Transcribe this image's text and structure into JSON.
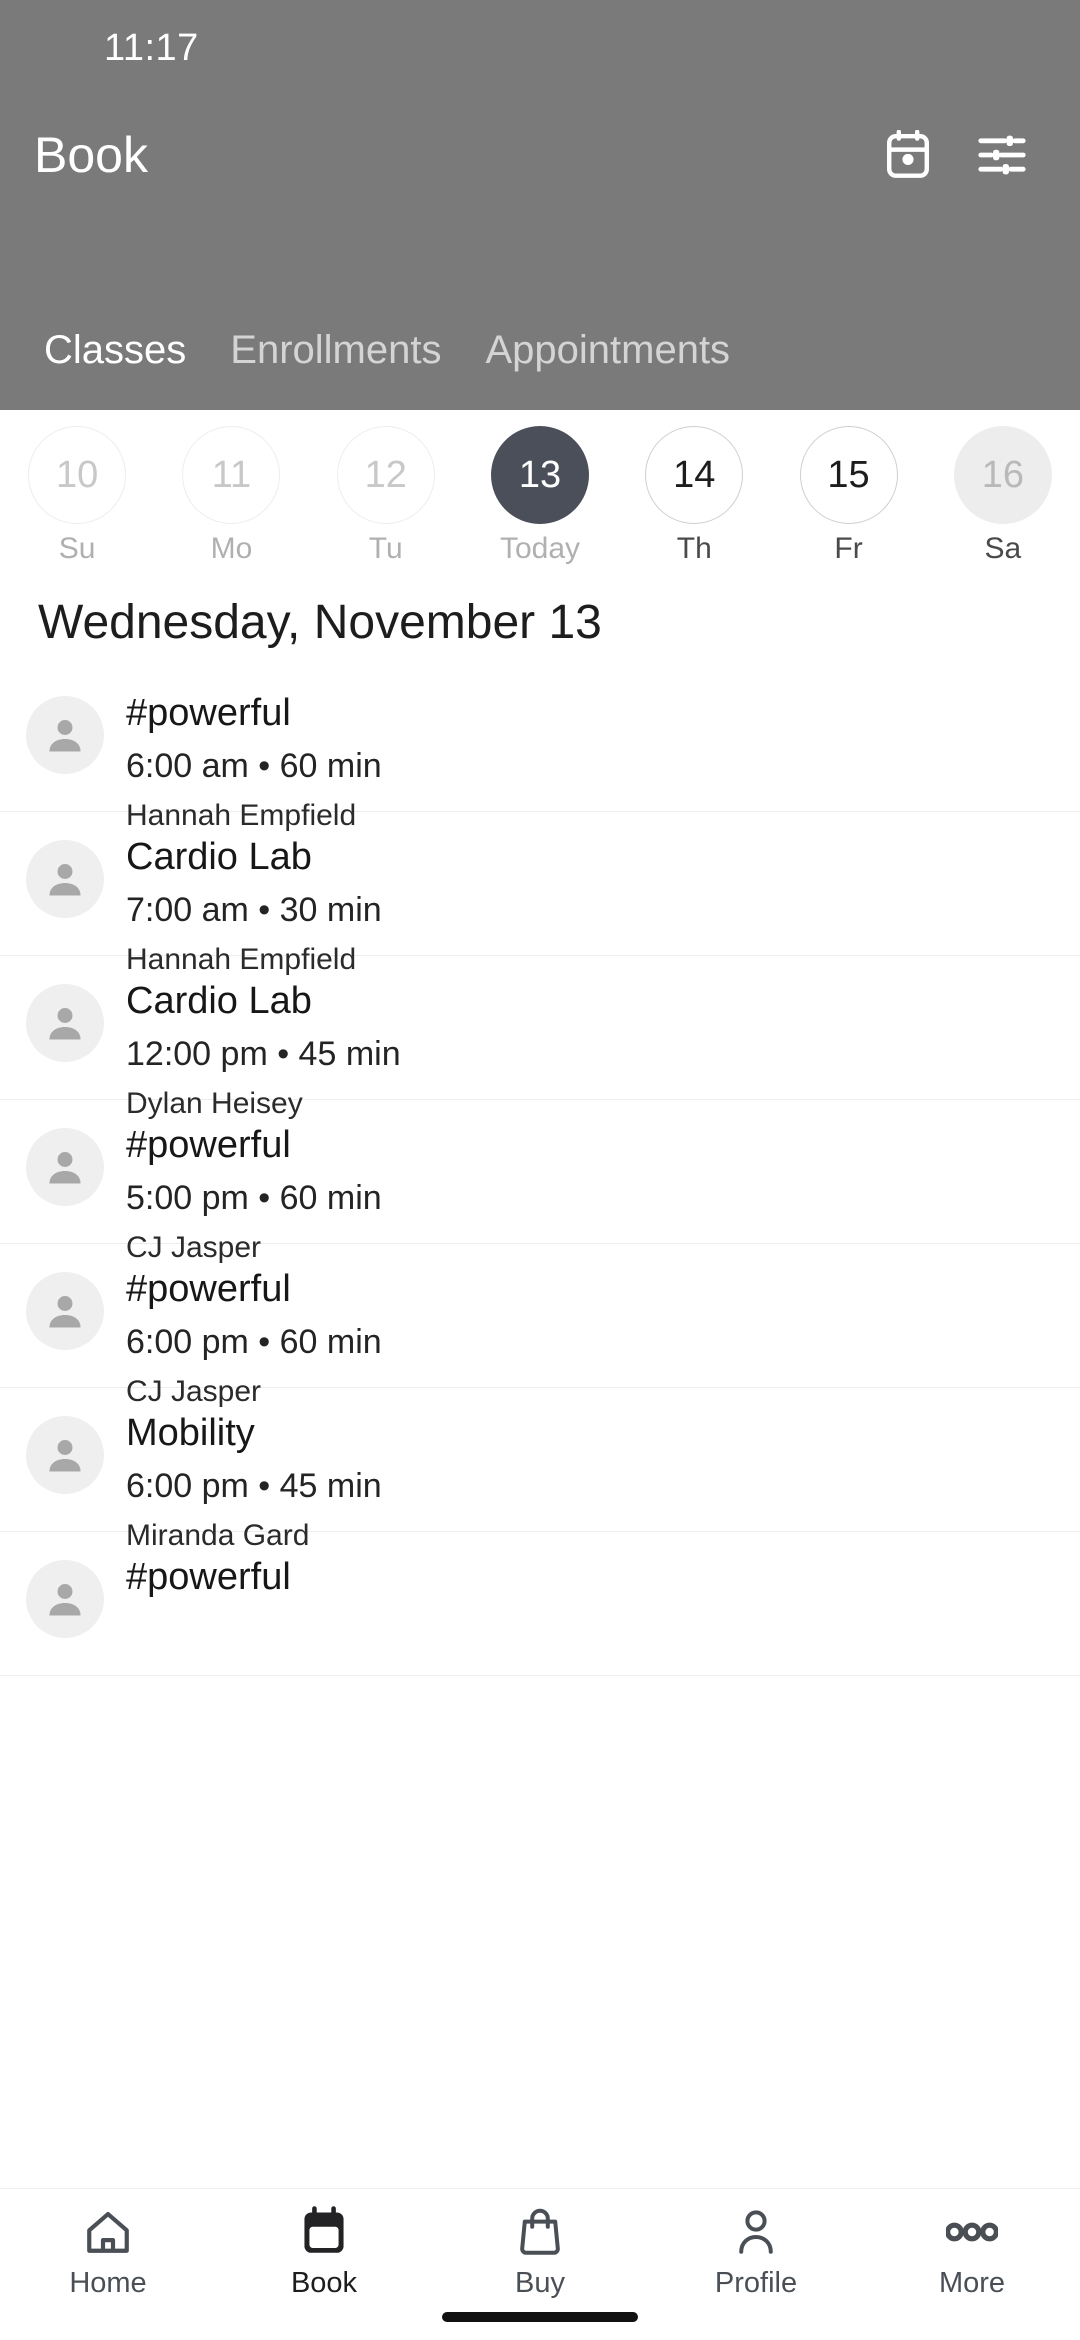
{
  "status_bar": {
    "time": "11:17"
  },
  "header": {
    "title": "Book",
    "bg_color": "#7a7a7a",
    "actions": [
      {
        "name": "calendar-icon",
        "label": "Calendar"
      },
      {
        "name": "filter-icon",
        "label": "Filters"
      }
    ],
    "tabs": [
      {
        "label": "Classes",
        "active": true
      },
      {
        "label": "Enrollments",
        "active": false
      },
      {
        "label": "Appointments",
        "active": false
      }
    ]
  },
  "date_strip": {
    "selected_accent": "#4a4f5a",
    "days": [
      {
        "num": "10",
        "label": "Su",
        "state": "past"
      },
      {
        "num": "11",
        "label": "Mo",
        "state": "past"
      },
      {
        "num": "12",
        "label": "Tu",
        "state": "past"
      },
      {
        "num": "13",
        "label": "Today",
        "state": "sel"
      },
      {
        "num": "14",
        "label": "Th",
        "state": "future"
      },
      {
        "num": "15",
        "label": "Fr",
        "state": "future"
      },
      {
        "num": "16",
        "label": "Sa",
        "state": "muted"
      }
    ]
  },
  "section": {
    "title": "Wednesday, November 13"
  },
  "classes": [
    {
      "title": "#powerful",
      "meta": "6:00 am • 60 min",
      "staff": "Hannah Empfield"
    },
    {
      "title": "Cardio Lab",
      "meta": "7:00 am • 30 min",
      "staff": "Hannah Empfield"
    },
    {
      "title": "Cardio Lab",
      "meta": "12:00 pm • 45 min",
      "staff": "Dylan Heisey"
    },
    {
      "title": "#powerful",
      "meta": "5:00 pm • 60 min",
      "staff": "CJ Jasper"
    },
    {
      "title": "#powerful",
      "meta": "6:00 pm • 60 min",
      "staff": "CJ Jasper"
    },
    {
      "title": "Mobility",
      "meta": "6:00 pm • 45 min",
      "staff": "Miranda Gard"
    },
    {
      "title": "#powerful",
      "meta": "",
      "staff": ""
    }
  ],
  "bottom_nav": {
    "items": [
      {
        "label": "Home",
        "icon": "home-icon",
        "active": false
      },
      {
        "label": "Book",
        "icon": "calendar-icon",
        "active": true
      },
      {
        "label": "Buy",
        "icon": "bag-icon",
        "active": false
      },
      {
        "label": "Profile",
        "icon": "person-icon",
        "active": false
      },
      {
        "label": "More",
        "icon": "dots-icon",
        "active": false
      }
    ]
  }
}
